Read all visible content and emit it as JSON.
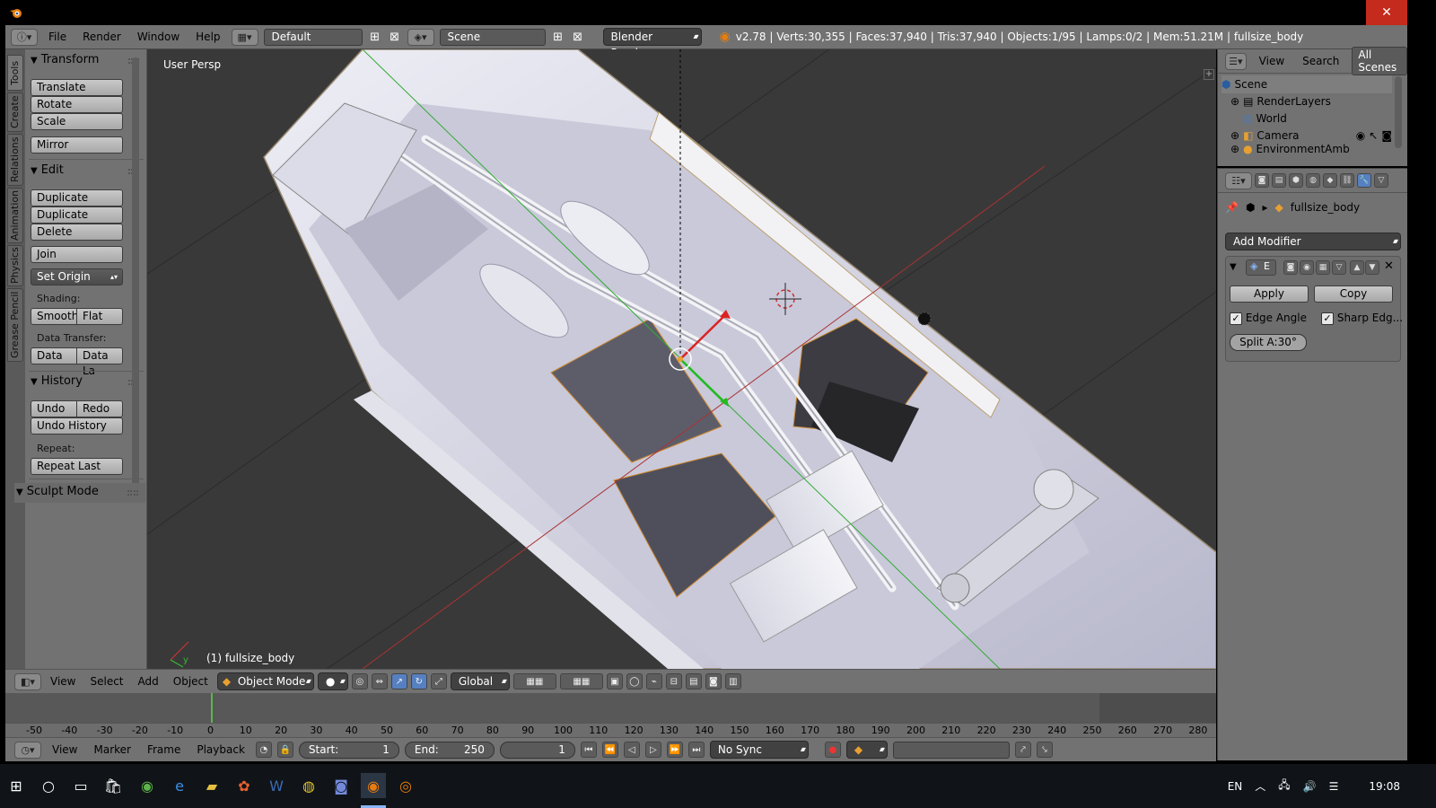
{
  "window": {
    "close": "✕",
    "maximize": "",
    "minimize": ""
  },
  "info": {
    "menus": [
      "File",
      "Render",
      "Window",
      "Help"
    ],
    "layout": "Default",
    "scene": "Scene",
    "engine": "Blender Render",
    "stats": "v2.78 | Verts:30,355 | Faces:37,940 | Tris:37,940 | Objects:1/95 | Lamps:0/2 | Mem:51.21M | fullsize_body"
  },
  "shelf_tabs": [
    "Tools",
    "Create",
    "Relations",
    "Animation",
    "Physics",
    "Grease Pencil"
  ],
  "toolshelf": {
    "transform": {
      "title": "Transform",
      "buttons": [
        "Translate",
        "Rotate",
        "Scale",
        "Mirror"
      ]
    },
    "edit": {
      "title": "Edit",
      "buttons": [
        "Duplicate",
        "Duplicate Linked",
        "Delete",
        "Join",
        "Set Origin"
      ]
    },
    "shading_label": "Shading:",
    "shading": [
      "Smooth",
      "Flat"
    ],
    "data_transfer_label": "Data Transfer:",
    "data_transfer": [
      "Data",
      "Data La"
    ],
    "history": {
      "title": "History",
      "undo": "Undo",
      "redo": "Redo",
      "undo_history": "Undo History",
      "repeat_label": "Repeat:",
      "repeat_last": "Repeat Last"
    },
    "sculpt": "Sculpt Mode"
  },
  "viewport": {
    "view_name": "User Persp",
    "object_label": "(1) fullsize_body",
    "axis_x": "x",
    "axis_y": "y"
  },
  "view_header": {
    "menus": [
      "View",
      "Select",
      "Add",
      "Object"
    ],
    "mode": "Object Mode",
    "orientation": "Global"
  },
  "timeline": {
    "ticks": [
      "-50",
      "-40",
      "-30",
      "-20",
      "-10",
      "0",
      "10",
      "20",
      "30",
      "40",
      "50",
      "60",
      "70",
      "80",
      "90",
      "100",
      "110",
      "120",
      "130",
      "140",
      "150",
      "160",
      "170",
      "180",
      "190",
      "200",
      "210",
      "220",
      "230",
      "240",
      "250",
      "260",
      "270",
      "280"
    ],
    "current_frame_value": 0
  },
  "timeline_header": {
    "menus": [
      "View",
      "Marker",
      "Frame",
      "Playback"
    ],
    "start_label": "Start:",
    "start": "1",
    "end_label": "End:",
    "end": "250",
    "current": "1",
    "sync": "No Sync"
  },
  "outliner": {
    "menus": [
      "View",
      "Search"
    ],
    "filter": "All Scenes",
    "items": [
      "Scene",
      "RenderLayers",
      "World",
      "Camera",
      "EnvironmentAmb"
    ]
  },
  "properties": {
    "object": "fullsize_body",
    "add_modifier": "Add Modifier",
    "modifier_short": "E",
    "apply": "Apply",
    "copy": "Copy",
    "edge_angle": "Edge Angle",
    "sharp_edges": "Sharp Edg...",
    "split_angle": "Split A:30°"
  },
  "taskbar": {
    "lang": "EN",
    "time": "19:08"
  },
  "colors": {
    "accent": "#5680c2",
    "viewport_bg": "#393939",
    "panel_bg": "#727272",
    "close_red": "#c42b1c",
    "frame_green": "#5eb44b"
  }
}
